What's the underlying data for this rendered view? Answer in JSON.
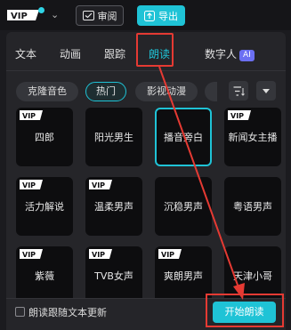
{
  "topbar": {
    "vip_logo_text": "VIP",
    "review_label": "审阅",
    "export_label": "导出"
  },
  "tabs": {
    "items": [
      {
        "label": "文本"
      },
      {
        "label": "动画"
      },
      {
        "label": "跟踪"
      },
      {
        "label": "朗读"
      },
      {
        "label": "数字人"
      }
    ],
    "ai_badge": "AI",
    "active_index": 3
  },
  "filters": {
    "chips": [
      {
        "label": "克隆音色"
      },
      {
        "label": "热门"
      },
      {
        "label": "影视动漫"
      }
    ],
    "active_index": 1
  },
  "voices": {
    "vip_badge": "VIP",
    "items": [
      {
        "name": "四郎",
        "vip": true
      },
      {
        "name": "阳光男生",
        "vip": false
      },
      {
        "name": "播音旁白",
        "vip": false,
        "selected": true
      },
      {
        "name": "新闻女主播",
        "vip": true
      },
      {
        "name": "活力解说",
        "vip": true
      },
      {
        "name": "温柔男声",
        "vip": true
      },
      {
        "name": "沉稳男声",
        "vip": false
      },
      {
        "name": "粤语男声",
        "vip": false
      },
      {
        "name": "紫薇",
        "vip": true
      },
      {
        "name": "TVB女声",
        "vip": true
      },
      {
        "name": "爽朗男声",
        "vip": true
      },
      {
        "name": "天津小哥",
        "vip": false
      }
    ]
  },
  "footer": {
    "follow_text_label": "朗读跟随文本更新",
    "follow_text_checked": false,
    "start_label": "开始朗读"
  },
  "colors": {
    "accent": "#1fc3d6",
    "annotation": "#e53a33",
    "ai_badge": "#6b6ff2"
  }
}
